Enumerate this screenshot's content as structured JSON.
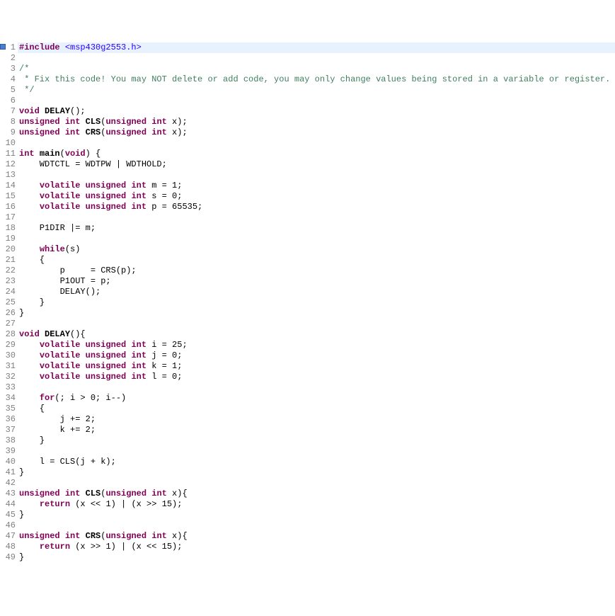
{
  "lines": [
    {
      "n": 1,
      "highlighted": true,
      "tokens": [
        {
          "cls": "kw-preproc",
          "t": "#include"
        },
        {
          "cls": "punct",
          "t": " "
        },
        {
          "cls": "include-file",
          "t": "<msp430g2553.h>"
        }
      ]
    },
    {
      "n": 2,
      "tokens": []
    },
    {
      "n": 3,
      "tokens": [
        {
          "cls": "comment",
          "t": "/*"
        }
      ]
    },
    {
      "n": 4,
      "tokens": [
        {
          "cls": "comment",
          "t": " * Fix this code! You may NOT delete or add code, you may only change values being stored in a variable or register."
        }
      ]
    },
    {
      "n": 5,
      "tokens": [
        {
          "cls": "comment",
          "t": " */"
        }
      ]
    },
    {
      "n": 6,
      "tokens": []
    },
    {
      "n": 7,
      "tokens": [
        {
          "cls": "kw",
          "t": "void"
        },
        {
          "cls": "punct",
          "t": " "
        },
        {
          "cls": "func",
          "t": "DELAY"
        },
        {
          "cls": "punct",
          "t": "();"
        }
      ]
    },
    {
      "n": 8,
      "tokens": [
        {
          "cls": "kw",
          "t": "unsigned"
        },
        {
          "cls": "punct",
          "t": " "
        },
        {
          "cls": "kw",
          "t": "int"
        },
        {
          "cls": "punct",
          "t": " "
        },
        {
          "cls": "func",
          "t": "CLS"
        },
        {
          "cls": "punct",
          "t": "("
        },
        {
          "cls": "kw",
          "t": "unsigned"
        },
        {
          "cls": "punct",
          "t": " "
        },
        {
          "cls": "kw",
          "t": "int"
        },
        {
          "cls": "punct",
          "t": " x);"
        }
      ]
    },
    {
      "n": 9,
      "tokens": [
        {
          "cls": "kw",
          "t": "unsigned"
        },
        {
          "cls": "punct",
          "t": " "
        },
        {
          "cls": "kw",
          "t": "int"
        },
        {
          "cls": "punct",
          "t": " "
        },
        {
          "cls": "func",
          "t": "CRS"
        },
        {
          "cls": "punct",
          "t": "("
        },
        {
          "cls": "kw",
          "t": "unsigned"
        },
        {
          "cls": "punct",
          "t": " "
        },
        {
          "cls": "kw",
          "t": "int"
        },
        {
          "cls": "punct",
          "t": " x);"
        }
      ]
    },
    {
      "n": 10,
      "tokens": []
    },
    {
      "n": 11,
      "tokens": [
        {
          "cls": "kw",
          "t": "int"
        },
        {
          "cls": "punct",
          "t": " "
        },
        {
          "cls": "func",
          "t": "main"
        },
        {
          "cls": "punct",
          "t": "("
        },
        {
          "cls": "kw",
          "t": "void"
        },
        {
          "cls": "punct",
          "t": ") {"
        }
      ]
    },
    {
      "n": 12,
      "tokens": [
        {
          "cls": "punct",
          "t": "    WDTCTL = WDTPW | WDTHOLD;"
        }
      ]
    },
    {
      "n": 13,
      "tokens": []
    },
    {
      "n": 14,
      "tokens": [
        {
          "cls": "punct",
          "t": "    "
        },
        {
          "cls": "kw",
          "t": "volatile"
        },
        {
          "cls": "punct",
          "t": " "
        },
        {
          "cls": "kw",
          "t": "unsigned"
        },
        {
          "cls": "punct",
          "t": " "
        },
        {
          "cls": "kw",
          "t": "int"
        },
        {
          "cls": "punct",
          "t": " m = 1;"
        }
      ]
    },
    {
      "n": 15,
      "tokens": [
        {
          "cls": "punct",
          "t": "    "
        },
        {
          "cls": "kw",
          "t": "volatile"
        },
        {
          "cls": "punct",
          "t": " "
        },
        {
          "cls": "kw",
          "t": "unsigned"
        },
        {
          "cls": "punct",
          "t": " "
        },
        {
          "cls": "kw",
          "t": "int"
        },
        {
          "cls": "punct",
          "t": " s = 0;"
        }
      ]
    },
    {
      "n": 16,
      "tokens": [
        {
          "cls": "punct",
          "t": "    "
        },
        {
          "cls": "kw",
          "t": "volatile"
        },
        {
          "cls": "punct",
          "t": " "
        },
        {
          "cls": "kw",
          "t": "unsigned"
        },
        {
          "cls": "punct",
          "t": " "
        },
        {
          "cls": "kw",
          "t": "int"
        },
        {
          "cls": "punct",
          "t": " p = 65535;"
        }
      ]
    },
    {
      "n": 17,
      "tokens": []
    },
    {
      "n": 18,
      "tokens": [
        {
          "cls": "punct",
          "t": "    P1DIR |= m;"
        }
      ]
    },
    {
      "n": 19,
      "tokens": []
    },
    {
      "n": 20,
      "tokens": [
        {
          "cls": "punct",
          "t": "    "
        },
        {
          "cls": "kw",
          "t": "while"
        },
        {
          "cls": "punct",
          "t": "(s)"
        }
      ]
    },
    {
      "n": 21,
      "tokens": [
        {
          "cls": "punct",
          "t": "    {"
        }
      ]
    },
    {
      "n": 22,
      "tokens": [
        {
          "cls": "punct",
          "t": "        p     = CRS(p);"
        }
      ]
    },
    {
      "n": 23,
      "tokens": [
        {
          "cls": "punct",
          "t": "        P1OUT = p;"
        }
      ]
    },
    {
      "n": 24,
      "tokens": [
        {
          "cls": "punct",
          "t": "        DELAY();"
        }
      ]
    },
    {
      "n": 25,
      "tokens": [
        {
          "cls": "punct",
          "t": "    }"
        }
      ]
    },
    {
      "n": 26,
      "tokens": [
        {
          "cls": "punct",
          "t": "}"
        }
      ]
    },
    {
      "n": 27,
      "tokens": []
    },
    {
      "n": 28,
      "tokens": [
        {
          "cls": "kw",
          "t": "void"
        },
        {
          "cls": "punct",
          "t": " "
        },
        {
          "cls": "func",
          "t": "DELAY"
        },
        {
          "cls": "punct",
          "t": "(){"
        }
      ]
    },
    {
      "n": 29,
      "tokens": [
        {
          "cls": "punct",
          "t": "    "
        },
        {
          "cls": "kw",
          "t": "volatile"
        },
        {
          "cls": "punct",
          "t": " "
        },
        {
          "cls": "kw",
          "t": "unsigned"
        },
        {
          "cls": "punct",
          "t": " "
        },
        {
          "cls": "kw",
          "t": "int"
        },
        {
          "cls": "punct",
          "t": " i = 25;"
        }
      ]
    },
    {
      "n": 30,
      "tokens": [
        {
          "cls": "punct",
          "t": "    "
        },
        {
          "cls": "kw",
          "t": "volatile"
        },
        {
          "cls": "punct",
          "t": " "
        },
        {
          "cls": "kw",
          "t": "unsigned"
        },
        {
          "cls": "punct",
          "t": " "
        },
        {
          "cls": "kw",
          "t": "int"
        },
        {
          "cls": "punct",
          "t": " j = 0;"
        }
      ]
    },
    {
      "n": 31,
      "tokens": [
        {
          "cls": "punct",
          "t": "    "
        },
        {
          "cls": "kw",
          "t": "volatile"
        },
        {
          "cls": "punct",
          "t": " "
        },
        {
          "cls": "kw",
          "t": "unsigned"
        },
        {
          "cls": "punct",
          "t": " "
        },
        {
          "cls": "kw",
          "t": "int"
        },
        {
          "cls": "punct",
          "t": " k = 1;"
        }
      ]
    },
    {
      "n": 32,
      "tokens": [
        {
          "cls": "punct",
          "t": "    "
        },
        {
          "cls": "kw",
          "t": "volatile"
        },
        {
          "cls": "punct",
          "t": " "
        },
        {
          "cls": "kw",
          "t": "unsigned"
        },
        {
          "cls": "punct",
          "t": " "
        },
        {
          "cls": "kw",
          "t": "int"
        },
        {
          "cls": "punct",
          "t": " l = 0;"
        }
      ]
    },
    {
      "n": 33,
      "tokens": []
    },
    {
      "n": 34,
      "tokens": [
        {
          "cls": "punct",
          "t": "    "
        },
        {
          "cls": "kw",
          "t": "for"
        },
        {
          "cls": "punct",
          "t": "(; i > 0; i--)"
        }
      ]
    },
    {
      "n": 35,
      "tokens": [
        {
          "cls": "punct",
          "t": "    {"
        }
      ]
    },
    {
      "n": 36,
      "tokens": [
        {
          "cls": "punct",
          "t": "        j += 2;"
        }
      ]
    },
    {
      "n": 37,
      "tokens": [
        {
          "cls": "punct",
          "t": "        k += 2;"
        }
      ]
    },
    {
      "n": 38,
      "tokens": [
        {
          "cls": "punct",
          "t": "    }"
        }
      ]
    },
    {
      "n": 39,
      "tokens": []
    },
    {
      "n": 40,
      "tokens": [
        {
          "cls": "punct",
          "t": "    l = CLS(j + k);"
        }
      ]
    },
    {
      "n": 41,
      "tokens": [
        {
          "cls": "punct",
          "t": "}"
        }
      ]
    },
    {
      "n": 42,
      "tokens": []
    },
    {
      "n": 43,
      "tokens": [
        {
          "cls": "kw",
          "t": "unsigned"
        },
        {
          "cls": "punct",
          "t": " "
        },
        {
          "cls": "kw",
          "t": "int"
        },
        {
          "cls": "punct",
          "t": " "
        },
        {
          "cls": "func",
          "t": "CLS"
        },
        {
          "cls": "punct",
          "t": "("
        },
        {
          "cls": "kw",
          "t": "unsigned"
        },
        {
          "cls": "punct",
          "t": " "
        },
        {
          "cls": "kw",
          "t": "int"
        },
        {
          "cls": "punct",
          "t": " x){"
        }
      ]
    },
    {
      "n": 44,
      "tokens": [
        {
          "cls": "punct",
          "t": "    "
        },
        {
          "cls": "kw",
          "t": "return"
        },
        {
          "cls": "punct",
          "t": " (x << 1) | (x >> 15);"
        }
      ]
    },
    {
      "n": 45,
      "tokens": [
        {
          "cls": "punct",
          "t": "}"
        }
      ]
    },
    {
      "n": 46,
      "tokens": []
    },
    {
      "n": 47,
      "tokens": [
        {
          "cls": "kw",
          "t": "unsigned"
        },
        {
          "cls": "punct",
          "t": " "
        },
        {
          "cls": "kw",
          "t": "int"
        },
        {
          "cls": "punct",
          "t": " "
        },
        {
          "cls": "func",
          "t": "CRS"
        },
        {
          "cls": "punct",
          "t": "("
        },
        {
          "cls": "kw",
          "t": "unsigned"
        },
        {
          "cls": "punct",
          "t": " "
        },
        {
          "cls": "kw",
          "t": "int"
        },
        {
          "cls": "punct",
          "t": " x){"
        }
      ]
    },
    {
      "n": 48,
      "tokens": [
        {
          "cls": "punct",
          "t": "    "
        },
        {
          "cls": "kw",
          "t": "return"
        },
        {
          "cls": "punct",
          "t": " (x >> 1) | (x << 15);"
        }
      ]
    },
    {
      "n": 49,
      "tokens": [
        {
          "cls": "punct",
          "t": "}"
        }
      ]
    }
  ]
}
